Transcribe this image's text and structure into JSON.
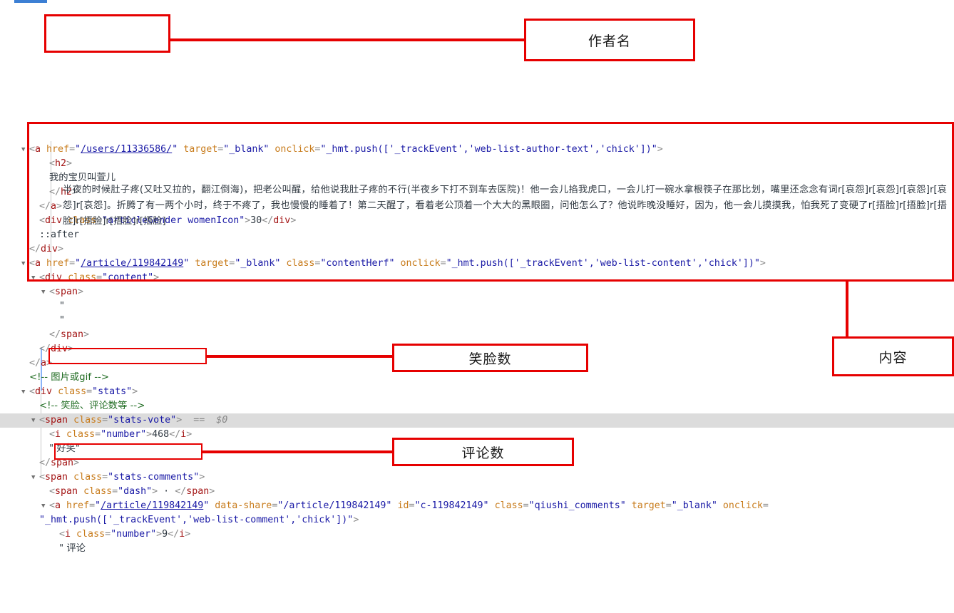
{
  "panel": {
    "name": "devtools-elements-panel"
  },
  "lines": [
    {
      "id": "l1",
      "indent": 0,
      "triangle": true,
      "parts": [
        {
          "t": "pnc",
          "s": "<"
        },
        {
          "t": "tag",
          "s": "a"
        },
        {
          "t": "pnc",
          "s": " "
        },
        {
          "t": "attr",
          "s": "href"
        },
        {
          "t": "pnc",
          "s": "="
        },
        {
          "t": "val",
          "s": "\""
        },
        {
          "t": "lnk",
          "s": "/users/11336586/"
        },
        {
          "t": "val",
          "s": "\""
        },
        {
          "t": "pnc",
          "s": " "
        },
        {
          "t": "attr",
          "s": "target"
        },
        {
          "t": "pnc",
          "s": "="
        },
        {
          "t": "val",
          "s": "\"_blank\""
        },
        {
          "t": "pnc",
          "s": " "
        },
        {
          "t": "attr",
          "s": "onclick"
        },
        {
          "t": "pnc",
          "s": "="
        },
        {
          "t": "val",
          "s": "\"_hmt.push(['_trackEvent','web-list-author-text','chick'])\""
        },
        {
          "t": "pnc",
          "s": ">"
        }
      ]
    },
    {
      "id": "l2",
      "indent": 2,
      "parts": [
        {
          "t": "pnc",
          "s": "<"
        },
        {
          "t": "tag",
          "s": "h2"
        },
        {
          "t": "pnc",
          "s": ">"
        }
      ]
    },
    {
      "id": "l3",
      "indent": 2,
      "parts": [
        {
          "t": "txt",
          "s": "我的宝贝叫萱儿"
        }
      ]
    },
    {
      "id": "l4",
      "indent": 2,
      "parts": [
        {
          "t": "pnc",
          "s": "</"
        },
        {
          "t": "tag",
          "s": "h2"
        },
        {
          "t": "pnc",
          "s": ">"
        }
      ]
    },
    {
      "id": "l5",
      "indent": 1,
      "parts": [
        {
          "t": "pnc",
          "s": "</"
        },
        {
          "t": "tag",
          "s": "a"
        },
        {
          "t": "pnc",
          "s": ">"
        }
      ]
    },
    {
      "id": "l6",
      "indent": 1,
      "parts": [
        {
          "t": "pnc",
          "s": "<"
        },
        {
          "t": "tag",
          "s": "div"
        },
        {
          "t": "pnc",
          "s": " "
        },
        {
          "t": "attr",
          "s": "class"
        },
        {
          "t": "pnc",
          "s": "="
        },
        {
          "t": "val",
          "s": "\"articleGender womenIcon\""
        },
        {
          "t": "pnc",
          "s": ">"
        },
        {
          "t": "txt",
          "s": "30"
        },
        {
          "t": "pnc",
          "s": "</"
        },
        {
          "t": "tag",
          "s": "div"
        },
        {
          "t": "pnc",
          "s": ">"
        }
      ]
    },
    {
      "id": "l7",
      "indent": 1,
      "parts": [
        {
          "t": "pseudo",
          "s": "::after"
        }
      ]
    },
    {
      "id": "l8",
      "indent": 0,
      "parts": [
        {
          "t": "pnc",
          "s": "</"
        },
        {
          "t": "tag",
          "s": "div"
        },
        {
          "t": "pnc",
          "s": ">"
        }
      ]
    },
    {
      "id": "l9",
      "indent": 0,
      "triangle": true,
      "parts": [
        {
          "t": "pnc",
          "s": "<"
        },
        {
          "t": "tag",
          "s": "a"
        },
        {
          "t": "pnc",
          "s": " "
        },
        {
          "t": "attr",
          "s": "href"
        },
        {
          "t": "pnc",
          "s": "="
        },
        {
          "t": "val",
          "s": "\""
        },
        {
          "t": "lnk",
          "s": "/article/119842149"
        },
        {
          "t": "val",
          "s": "\""
        },
        {
          "t": "pnc",
          "s": " "
        },
        {
          "t": "attr",
          "s": "target"
        },
        {
          "t": "pnc",
          "s": "="
        },
        {
          "t": "val",
          "s": "\"_blank\""
        },
        {
          "t": "pnc",
          "s": " "
        },
        {
          "t": "attr",
          "s": "class"
        },
        {
          "t": "pnc",
          "s": "="
        },
        {
          "t": "val",
          "s": "\"contentHerf\""
        },
        {
          "t": "pnc",
          "s": " "
        },
        {
          "t": "attr",
          "s": "onclick"
        },
        {
          "t": "pnc",
          "s": "="
        },
        {
          "t": "val",
          "s": "\"_hmt.push(['_trackEvent','web-list-content','chick'])\""
        },
        {
          "t": "pnc",
          "s": ">"
        }
      ]
    },
    {
      "id": "l10",
      "indent": 1,
      "triangle": true,
      "parts": [
        {
          "t": "pnc",
          "s": "<"
        },
        {
          "t": "tag",
          "s": "div"
        },
        {
          "t": "pnc",
          "s": " "
        },
        {
          "t": "attr",
          "s": "class"
        },
        {
          "t": "pnc",
          "s": "="
        },
        {
          "t": "val",
          "s": "\"content\""
        },
        {
          "t": "pnc",
          "s": ">"
        }
      ]
    },
    {
      "id": "l11",
      "indent": 2,
      "triangle": true,
      "parts": [
        {
          "t": "pnc",
          "s": "<"
        },
        {
          "t": "tag",
          "s": "span"
        },
        {
          "t": "pnc",
          "s": ">"
        }
      ]
    },
    {
      "id": "l12",
      "indent": 3,
      "parts": [
        {
          "t": "txt",
          "s": "\""
        }
      ]
    },
    {
      "id": "l13",
      "indent": 3,
      "parts": [
        {
          "t": "txt",
          "s": "\""
        }
      ]
    },
    {
      "id": "l14",
      "indent": 2,
      "parts": [
        {
          "t": "pnc",
          "s": "</"
        },
        {
          "t": "tag",
          "s": "span"
        },
        {
          "t": "pnc",
          "s": ">"
        }
      ]
    },
    {
      "id": "l15",
      "indent": 1,
      "parts": [
        {
          "t": "pnc",
          "s": "</"
        },
        {
          "t": "tag",
          "s": "div"
        },
        {
          "t": "pnc",
          "s": ">"
        }
      ]
    },
    {
      "id": "l16",
      "indent": 0,
      "parts": [
        {
          "t": "pnc",
          "s": "</"
        },
        {
          "t": "tag",
          "s": "a"
        },
        {
          "t": "pnc",
          "s": ">"
        }
      ]
    },
    {
      "id": "l17",
      "indent": 0,
      "parts": [
        {
          "t": "cmt",
          "s": "<!-- 图片或gif -->"
        }
      ]
    },
    {
      "id": "l18",
      "indent": 0,
      "triangle": true,
      "parts": [
        {
          "t": "pnc",
          "s": "<"
        },
        {
          "t": "tag",
          "s": "div"
        },
        {
          "t": "pnc",
          "s": " "
        },
        {
          "t": "attr",
          "s": "class"
        },
        {
          "t": "pnc",
          "s": "="
        },
        {
          "t": "val",
          "s": "\"stats\""
        },
        {
          "t": "pnc",
          "s": ">"
        }
      ]
    },
    {
      "id": "l19",
      "indent": 1,
      "parts": [
        {
          "t": "cmt",
          "s": "<!-- 笑脸、评论数等 -->"
        }
      ]
    },
    {
      "id": "l20",
      "indent": 1,
      "triangle": true,
      "highlighted": true,
      "parts": [
        {
          "t": "pnc",
          "s": "<"
        },
        {
          "t": "tag",
          "s": "span"
        },
        {
          "t": "pnc",
          "s": " "
        },
        {
          "t": "attr",
          "s": "class"
        },
        {
          "t": "pnc",
          "s": "="
        },
        {
          "t": "val",
          "s": "\"stats-vote\""
        },
        {
          "t": "pnc",
          "s": ">"
        },
        {
          "t": "sel",
          "s": "  ==  $0"
        }
      ]
    },
    {
      "id": "l21",
      "indent": 2,
      "parts": [
        {
          "t": "pnc",
          "s": "<"
        },
        {
          "t": "tag",
          "s": "i"
        },
        {
          "t": "pnc",
          "s": " "
        },
        {
          "t": "attr",
          "s": "class"
        },
        {
          "t": "pnc",
          "s": "="
        },
        {
          "t": "val",
          "s": "\"number\""
        },
        {
          "t": "pnc",
          "s": ">"
        },
        {
          "t": "txt",
          "s": "468"
        },
        {
          "t": "pnc",
          "s": "</"
        },
        {
          "t": "tag",
          "s": "i"
        },
        {
          "t": "pnc",
          "s": ">"
        }
      ]
    },
    {
      "id": "l22",
      "indent": 2,
      "parts": [
        {
          "t": "txt",
          "s": "\" 好笑\""
        }
      ]
    },
    {
      "id": "l23",
      "indent": 1,
      "parts": [
        {
          "t": "pnc",
          "s": "</"
        },
        {
          "t": "tag",
          "s": "span"
        },
        {
          "t": "pnc",
          "s": ">"
        }
      ]
    },
    {
      "id": "l24",
      "indent": 1,
      "triangle": true,
      "parts": [
        {
          "t": "pnc",
          "s": "<"
        },
        {
          "t": "tag",
          "s": "span"
        },
        {
          "t": "pnc",
          "s": " "
        },
        {
          "t": "attr",
          "s": "class"
        },
        {
          "t": "pnc",
          "s": "="
        },
        {
          "t": "val",
          "s": "\"stats-comments\""
        },
        {
          "t": "pnc",
          "s": ">"
        }
      ]
    },
    {
      "id": "l25",
      "indent": 2,
      "parts": [
        {
          "t": "pnc",
          "s": "<"
        },
        {
          "t": "tag",
          "s": "span"
        },
        {
          "t": "pnc",
          "s": " "
        },
        {
          "t": "attr",
          "s": "class"
        },
        {
          "t": "pnc",
          "s": "="
        },
        {
          "t": "val",
          "s": "\"dash\""
        },
        {
          "t": "pnc",
          "s": "> "
        },
        {
          "t": "txt",
          "s": "·"
        },
        {
          "t": "pnc",
          "s": " </"
        },
        {
          "t": "tag",
          "s": "span"
        },
        {
          "t": "pnc",
          "s": ">"
        }
      ]
    },
    {
      "id": "l26",
      "indent": 2,
      "triangle": true,
      "parts": [
        {
          "t": "pnc",
          "s": "<"
        },
        {
          "t": "tag",
          "s": "a"
        },
        {
          "t": "pnc",
          "s": " "
        },
        {
          "t": "attr",
          "s": "href"
        },
        {
          "t": "pnc",
          "s": "="
        },
        {
          "t": "val",
          "s": "\""
        },
        {
          "t": "lnk",
          "s": "/article/119842149"
        },
        {
          "t": "val",
          "s": "\""
        },
        {
          "t": "pnc",
          "s": " "
        },
        {
          "t": "attr",
          "s": "data-share"
        },
        {
          "t": "pnc",
          "s": "="
        },
        {
          "t": "val",
          "s": "\"/article/119842149\""
        },
        {
          "t": "pnc",
          "s": " "
        },
        {
          "t": "attr",
          "s": "id"
        },
        {
          "t": "pnc",
          "s": "="
        },
        {
          "t": "val",
          "s": "\"c-119842149\""
        },
        {
          "t": "pnc",
          "s": " "
        },
        {
          "t": "attr",
          "s": "class"
        },
        {
          "t": "pnc",
          "s": "="
        },
        {
          "t": "val",
          "s": "\"qiushi_comments\""
        },
        {
          "t": "pnc",
          "s": " "
        },
        {
          "t": "attr",
          "s": "target"
        },
        {
          "t": "pnc",
          "s": "="
        },
        {
          "t": "val",
          "s": "\"_blank\""
        },
        {
          "t": "pnc",
          "s": " "
        },
        {
          "t": "attr",
          "s": "onclick"
        },
        {
          "t": "pnc",
          "s": "="
        }
      ]
    },
    {
      "id": "l27",
      "indent": 1,
      "parts": [
        {
          "t": "val",
          "s": "\"_hmt.push(['_trackEvent','web-list-comment','chick'])\""
        },
        {
          "t": "pnc",
          "s": ">"
        }
      ]
    },
    {
      "id": "l28",
      "indent": 3,
      "parts": [
        {
          "t": "pnc",
          "s": "<"
        },
        {
          "t": "tag",
          "s": "i"
        },
        {
          "t": "pnc",
          "s": " "
        },
        {
          "t": "attr",
          "s": "class"
        },
        {
          "t": "pnc",
          "s": "="
        },
        {
          "t": "val",
          "s": "\"number\""
        },
        {
          "t": "pnc",
          "s": ">"
        },
        {
          "t": "txt",
          "s": "9"
        },
        {
          "t": "pnc",
          "s": "</"
        },
        {
          "t": "tag",
          "s": "i"
        },
        {
          "t": "pnc",
          "s": ">"
        }
      ]
    },
    {
      "id": "l29",
      "indent": 3,
      "parts": [
        {
          "t": "txt",
          "s": "\" 评论"
        }
      ]
    }
  ],
  "article": {
    "content_text": "半夜的时候肚子疼(又吐又拉的，翻江倒海)，把老公叫醒，给他说我肚子疼的不行(半夜乡下打不到车去医院)！他一会儿掐我虎口，一会儿打一碗水拿根筷子在那比划，嘴里还念念有词r[哀怨]r[哀怨]r[哀怨]r[哀怨]r[哀怨]。折腾了有一两个小时，终于不疼了，我也慢慢的睡着了！第二天醒了，看着老公顶着一个大大的黑眼圈，问他怎么了？他说昨晚没睡好，因为，他一会儿摸摸我，怕我死了变硬了r[捂脸]r[捂脸]r[捂脸]r[捂脸]r[捂脸]r[捂脸]"
  },
  "annotations": {
    "author_label": "作者名",
    "content_label": "内容",
    "vote_label": "笑脸数",
    "comment_label": "评论数"
  },
  "colors": {
    "annotation_red": "#e60000",
    "tag": "#a31515",
    "attribute": "#c87c1c",
    "value": "#1a1aa6",
    "comment": "#236e25",
    "highlight_row": "#dcdcdc"
  }
}
